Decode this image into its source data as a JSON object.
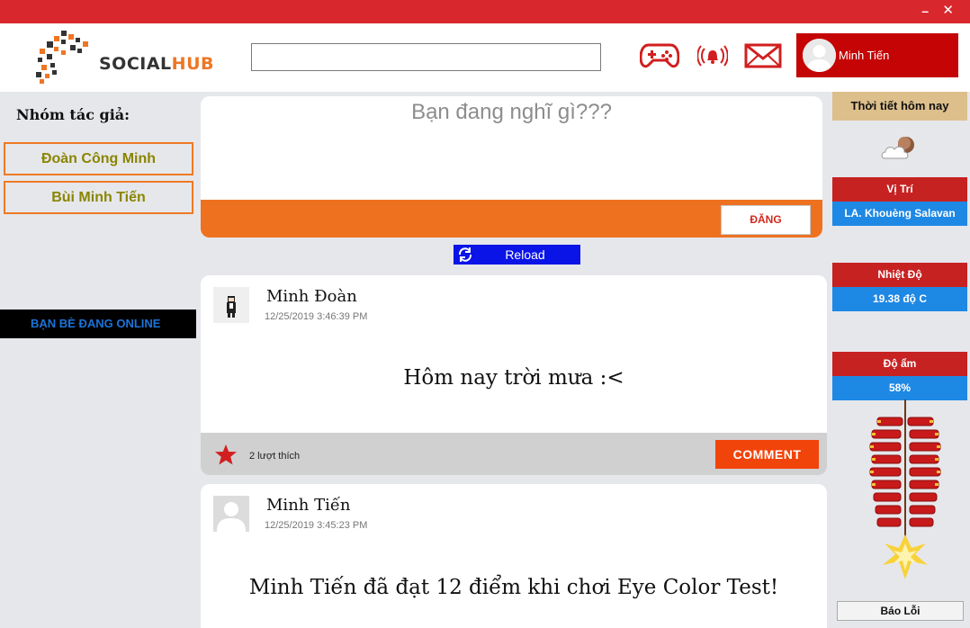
{
  "window": {
    "minimize": "–",
    "close": "✕"
  },
  "header": {
    "logo_part1": "SOCIAL",
    "logo_part2": "HUB",
    "search_value": "",
    "user_name": "Minh Tiến",
    "icons": [
      "gamepad-icon",
      "notification-bell-icon",
      "mail-icon"
    ]
  },
  "sidebar": {
    "group_title": "Nhóm tác giả:",
    "authors": [
      "Đoàn Công Minh",
      "Bùi Minh Tiến"
    ],
    "online_label": "BẠN BÈ ĐANG ONLINE"
  },
  "compose": {
    "placeholder": "Bạn đang nghĩ gì???",
    "post_label": "ĐĂNG"
  },
  "reload_label": "Reload",
  "posts": [
    {
      "author": "Minh Đoàn",
      "date": "12/25/2019 3:46:39 PM",
      "content": "Hôm nay trời mưa :<",
      "likes": "2 lượt thích",
      "comment_label": "COMMENT"
    },
    {
      "author": "Minh Tiến",
      "date": "12/25/2019 3:45:23 PM",
      "content": "Minh Tiến đã đạt 12 điểm khi chơi Eye Color Test!"
    }
  ],
  "weather": {
    "title": "Thời tiết hôm nay",
    "icon": "cloud-moon-icon",
    "location_label": "Vị Trí",
    "location": "LA. Khouèng Salavan",
    "temp_label": "Nhiệt Độ",
    "temp": "19.38 độ C",
    "humidity_label": "Độ ẩm",
    "humidity": "58%",
    "report_label": "Báo Lỗi"
  },
  "colors": {
    "titlebar": "#d9272e",
    "brand_orange": "#ee7120",
    "user_box": "#c50405",
    "reload": "#0a14e6",
    "comment": "#f1440b",
    "weather_label": "#c72222",
    "weather_value": "#1e88e5"
  }
}
